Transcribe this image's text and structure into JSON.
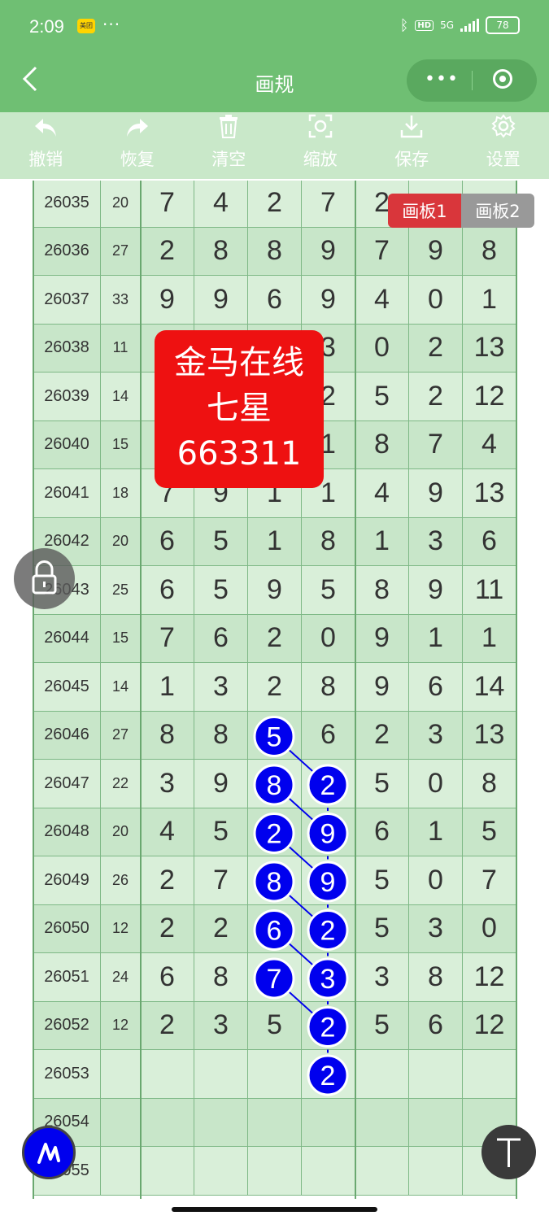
{
  "status_bar": {
    "time": "2:09",
    "app_badge": "美团",
    "more": "···",
    "hd": "HD",
    "network": "5G",
    "battery": "78"
  },
  "nav": {
    "title": "画规",
    "more": "•••"
  },
  "toolbar": [
    {
      "icon": "undo-icon",
      "label": "撤销"
    },
    {
      "icon": "redo-icon",
      "label": "恢复"
    },
    {
      "icon": "trash-icon",
      "label": "清空"
    },
    {
      "icon": "zoom-icon",
      "label": "缩放"
    },
    {
      "icon": "download-icon",
      "label": "保存"
    },
    {
      "icon": "gear-icon",
      "label": "设置"
    }
  ],
  "board_tabs": {
    "tab1": "画板1",
    "tab2": "画板2"
  },
  "ad": {
    "line1": "金马在线",
    "line2": "七星",
    "line3": "663311"
  },
  "rows": [
    {
      "period": "26035",
      "sum": "20",
      "digits": [
        "7",
        "4",
        "2",
        "7",
        "2",
        "",
        ""
      ]
    },
    {
      "period": "26036",
      "sum": "27",
      "digits": [
        "2",
        "8",
        "8",
        "9",
        "7",
        "9",
        "8"
      ]
    },
    {
      "period": "26037",
      "sum": "33",
      "digits": [
        "9",
        "9",
        "6",
        "9",
        "4",
        "0",
        "1"
      ]
    },
    {
      "period": "26038",
      "sum": "11",
      "digits": [
        "",
        "",
        "",
        "3",
        "0",
        "2",
        "13"
      ]
    },
    {
      "period": "26039",
      "sum": "14",
      "digits": [
        "",
        "",
        "",
        "2",
        "5",
        "2",
        "12"
      ]
    },
    {
      "period": "26040",
      "sum": "15",
      "digits": [
        "",
        "",
        "",
        "1",
        "8",
        "7",
        "4"
      ]
    },
    {
      "period": "26041",
      "sum": "18",
      "digits": [
        "7",
        "9",
        "1",
        "1",
        "4",
        "9",
        "13"
      ]
    },
    {
      "period": "26042",
      "sum": "20",
      "digits": [
        "6",
        "5",
        "1",
        "8",
        "1",
        "3",
        "6"
      ]
    },
    {
      "period": "26043",
      "sum": "25",
      "digits": [
        "6",
        "5",
        "9",
        "5",
        "8",
        "9",
        "11"
      ]
    },
    {
      "period": "26044",
      "sum": "15",
      "digits": [
        "7",
        "6",
        "2",
        "0",
        "9",
        "1",
        "1"
      ]
    },
    {
      "period": "26045",
      "sum": "14",
      "digits": [
        "1",
        "3",
        "2",
        "8",
        "9",
        "6",
        "14"
      ]
    },
    {
      "period": "26046",
      "sum": "27",
      "digits": [
        "8",
        "8",
        "",
        "6",
        "2",
        "3",
        "13"
      ]
    },
    {
      "period": "26047",
      "sum": "22",
      "digits": [
        "3",
        "9",
        "",
        "",
        "5",
        "0",
        "8"
      ]
    },
    {
      "period": "26048",
      "sum": "20",
      "digits": [
        "4",
        "5",
        "",
        "",
        "6",
        "1",
        "5"
      ]
    },
    {
      "period": "26049",
      "sum": "26",
      "digits": [
        "2",
        "7",
        "",
        "",
        "5",
        "0",
        "7"
      ]
    },
    {
      "period": "26050",
      "sum": "12",
      "digits": [
        "2",
        "2",
        "",
        "",
        "5",
        "3",
        "0"
      ]
    },
    {
      "period": "26051",
      "sum": "24",
      "digits": [
        "6",
        "8",
        "",
        "",
        "3",
        "8",
        "12"
      ]
    },
    {
      "period": "26052",
      "sum": "12",
      "digits": [
        "2",
        "3",
        "5",
        "",
        "5",
        "6",
        "12"
      ]
    },
    {
      "period": "26053",
      "sum": "",
      "digits": [
        "",
        "",
        "",
        "",
        "",
        "",
        ""
      ]
    },
    {
      "period": "26054",
      "sum": "",
      "digits": [
        "",
        "",
        "",
        "",
        "",
        "",
        ""
      ]
    },
    {
      "period": "26055",
      "sum": "",
      "digits": [
        "",
        "",
        "",
        "",
        "",
        "",
        ""
      ]
    }
  ],
  "markers": [
    {
      "row": 11,
      "col": 2,
      "value": "5"
    },
    {
      "row": 12,
      "col": 2,
      "value": "8"
    },
    {
      "row": 12,
      "col": 3,
      "value": "2"
    },
    {
      "row": 13,
      "col": 2,
      "value": "2"
    },
    {
      "row": 13,
      "col": 3,
      "value": "9"
    },
    {
      "row": 14,
      "col": 2,
      "value": "8"
    },
    {
      "row": 14,
      "col": 3,
      "value": "9"
    },
    {
      "row": 15,
      "col": 2,
      "value": "6"
    },
    {
      "row": 15,
      "col": 3,
      "value": "2"
    },
    {
      "row": 16,
      "col": 2,
      "value": "7"
    },
    {
      "row": 16,
      "col": 3,
      "value": "3"
    },
    {
      "row": 17,
      "col": 3,
      "value": "2"
    },
    {
      "row": 18,
      "col": 3,
      "value": "2"
    }
  ],
  "colors": {
    "header_green": "#6fbf73",
    "toolbar_green": "#c9e8c9",
    "marker_blue": "#0000ee",
    "ad_red": "#ee1111",
    "tab_active": "#d9363b"
  }
}
